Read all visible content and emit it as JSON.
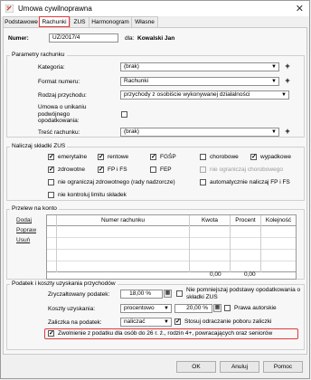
{
  "window": {
    "title": "Umowa cywilnoprawna",
    "close": "✕"
  },
  "tabs": [
    "Podstawowe",
    "Rachunki",
    "ZUS",
    "Harmonogram",
    "Własne"
  ],
  "header": {
    "numer_label": "Numer:",
    "numer_value": "UZ/2017/4",
    "dla_label": "dla:",
    "dla_value": "Kowalski Jan"
  },
  "params": {
    "title": "Parametry rachunku",
    "kategoria_label": "Kategoria:",
    "kategoria_value": "(brak)",
    "format_label": "Format numeru:",
    "format_value": "Rachunki",
    "rodzaj_label": "Rodzaj przychodu:",
    "rodzaj_value": "przychody z osobiście wykonywanej działalności",
    "umowa_label": "Umowa o unikaniu podwójnego opodatkowania:",
    "tresc_label": "Treść rachunku:",
    "tresc_value": "(brak)"
  },
  "zus": {
    "title": "Naliczaj składki ZUS",
    "emerytalne": "emerytalne",
    "rentowe": "rentowe",
    "fgsp": "FGŚP",
    "chorobowe": "chorobowe",
    "wypadkowe": "wypadkowe",
    "zdrowotne": "zdrowotne",
    "fpfs": "FP i FS",
    "fep": "FEP",
    "nie_ogr_chor": "nie ograniczaj chorobowego",
    "nie_ogr_zdr": "nie ograniczaj zdrowotnego (rady nadzorcze)",
    "auto_fp": "automatycznie naliczaj FP i FS",
    "nie_kontroluj": "nie kontroluj limitu składek"
  },
  "konto": {
    "title": "Przelew na konto",
    "dodaj": "Dodaj",
    "popraw": "Popraw",
    "usun": "Usuń",
    "columns": [
      "Numer rachunku",
      "Kwota",
      "Procent",
      "Kolejność"
    ],
    "sum_kwota": "0,00",
    "sum_procent": "0,00"
  },
  "podatek": {
    "title": "Podatek i koszty uzyskania przychodów",
    "zryczalt_label": "Zryczałtowany podatek:",
    "zryczalt_value": "18,00 %",
    "nie_pomniejszaj": "Nie pomniejszaj podstawy opodatkowania o składki ZUS",
    "koszty_label": "Koszty uzyskania:",
    "koszty_select": "procentowo",
    "koszty_value": "20,00 %",
    "prawa_autorskie": "Prawa autorskie",
    "zaliczka_label": "Zaliczka na podatek:",
    "zaliczka_value": "naliczać",
    "stosuj_odr": "Stosuj odraczanie poboru zaliczki",
    "zwolnienie": "Zwolnienie z podatku dla osób do 26 r. ż., rodzin 4+, powracających oraz seniorów"
  },
  "buttons": {
    "ok": "OK",
    "anuluj": "Anuluj",
    "pomoc": "Pomoc"
  },
  "colors": {
    "highlight": "#e23a3a"
  }
}
